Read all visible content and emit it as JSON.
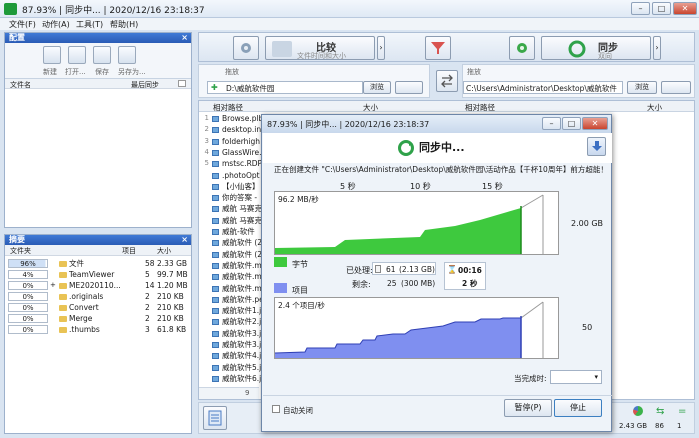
{
  "window": {
    "title": "87.93% | 同步中... | 2020/12/16 23:18:37",
    "min": "–",
    "max": "□",
    "close": "✕"
  },
  "menu": [
    "文件(F)",
    "动作(A)",
    "工具(T)",
    "帮助(H)"
  ],
  "config_panel": {
    "title": "配置",
    "close": "×",
    "buttons": [
      "新建",
      "打开...",
      "保存",
      "另存为..."
    ],
    "col_file": "文件名",
    "col_last_sync": "最后同步"
  },
  "summary_panel": {
    "title": "摘要",
    "close": "×",
    "cols": [
      "文件夹",
      "项目",
      "大小"
    ],
    "rows": [
      {
        "pct": "96%",
        "name": "文件",
        "items": "58",
        "size": "2.33 GB"
      },
      {
        "pct": "4%",
        "name": "TeamViewer",
        "items": "5",
        "size": "99.7 MB"
      },
      {
        "pct": "0%",
        "name": "ME2020110...",
        "items": "14",
        "size": "1.20 MB"
      },
      {
        "pct": "0%",
        "name": ".originals",
        "items": "2",
        "size": "210 KB"
      },
      {
        "pct": "0%",
        "name": "Convert",
        "items": "2",
        "size": "210 KB"
      },
      {
        "pct": "0%",
        "name": "Merge",
        "items": "2",
        "size": "210 KB"
      },
      {
        "pct": "0%",
        "name": ".thumbs",
        "items": "3",
        "size": "61.8 KB"
      }
    ],
    "plus": "+"
  },
  "toolbar": {
    "compare": "比较",
    "compare_sub": "文件时间和大小",
    "sync": "同步",
    "sync_sub": "双向",
    "arrow": "›"
  },
  "left_folder": {
    "label": "拖放",
    "path": "D:\\威航软件园",
    "browse": "浏览"
  },
  "right_folder": {
    "label": "拖放",
    "path": "C:\\Users\\Administrator\\Desktop\\威航软件",
    "browse": "浏览"
  },
  "grid": {
    "col_rel": "相对路径",
    "col_size": "大小",
    "rows": [
      "Browse.plb",
      "desktop.in",
      "folderhigh",
      "GlassWire.",
      "mstsc.RDP",
      ".photoOpt",
      "【小仙客】",
      "你的答案 -",
      "威航 马赛克",
      "威航 马赛克",
      "威航-软件",
      "威航软件 (2",
      "威航软件 (2",
      "威航软件.m",
      "威航软件.m",
      "威航软件.m",
      "威航软件.pe",
      "威航软件1.j",
      "威航软件2.j",
      "威航软件3.j",
      "威航软件3.j",
      "威航软件4.j",
      "威航软件5.j",
      "威航软件6.j"
    ],
    "footer_count": "9"
  },
  "statusbar": {
    "size": "2.43 GB",
    "count1": "86",
    "count2": "1"
  },
  "dialog": {
    "title": "87.93% | 同步中... | 2020/12/16 23:18:37",
    "header": "同步中...",
    "creating": "正在创建文件 \"C:\\Users\\Administrator\\Desktop\\威航软件园\\活动作品【千杯10周年】前方超能！",
    "ticks": [
      "5 秒",
      "10 秒",
      "15 秒"
    ],
    "rate_bytes": "96.2 MB/秒",
    "max_bytes": "2.00 GB",
    "legend_bytes": "字节",
    "rate_items": "2.4 个项目/秒",
    "max_items": "50",
    "legend_items": "项目",
    "processed_label": "已处理:",
    "processed_count": "61",
    "processed_size": "(2.13 GB)",
    "remaining_label": "剩余:",
    "remaining_count": "25",
    "remaining_size": "(300 MB)",
    "elapsed": "00:16",
    "remaining_time": "2 秒",
    "when_done": "当完成时:",
    "auto_close": "自动关闭",
    "pause": "暂停(P)",
    "stop": "停止",
    "colors": {
      "bytes": "#3ec93e",
      "items": "#7f8ff0"
    }
  }
}
